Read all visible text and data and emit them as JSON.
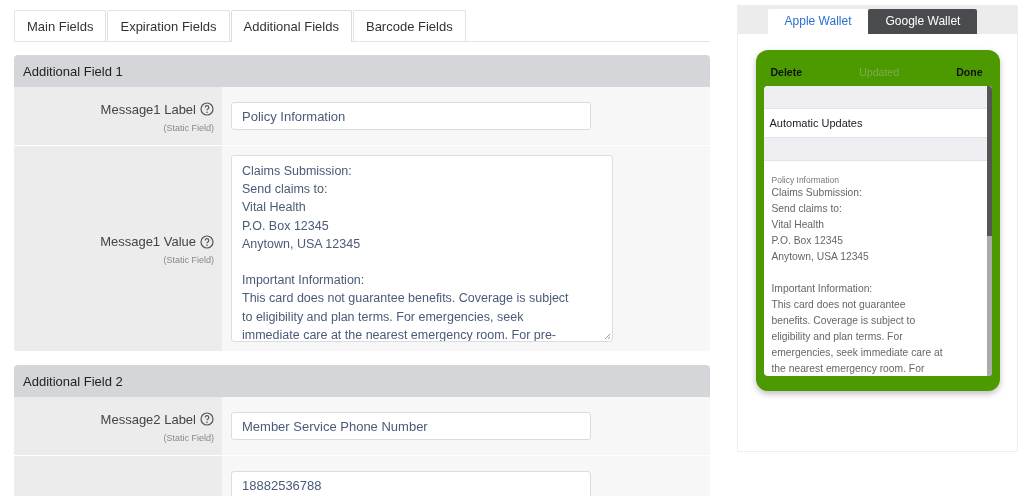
{
  "tabs": [
    {
      "label": "Main Fields",
      "selected": false
    },
    {
      "label": "Expiration Fields",
      "selected": false
    },
    {
      "label": "Additional Fields",
      "selected": true
    },
    {
      "label": "Barcode Fields",
      "selected": false
    }
  ],
  "sections": [
    {
      "title": "Additional Field 1",
      "rows": [
        {
          "kind": "input",
          "label": "Message1 Label",
          "note": "(Static Field)",
          "value": "Policy Information"
        },
        {
          "kind": "textarea",
          "label": "Message1 Value",
          "note": "(Static Field)",
          "paragraphs": [
            [
              "Claims Submission:",
              "Send claims to:",
              "Vital Health",
              "P.O. Box 12345",
              "Anytown, USA 12345"
            ],
            [
              "Important Information:",
              "This card does not guarantee benefits. Coverage is subject",
              "to eligibility and plan terms. For emergencies, seek",
              "immediate care at the nearest emergency room. For pre-"
            ]
          ]
        }
      ]
    },
    {
      "title": "Additional Field 2",
      "rows": [
        {
          "kind": "input",
          "label": "Message2 Label",
          "note": "(Static Field)",
          "value": "Member Service Phone Number"
        },
        {
          "kind": "input",
          "value": "18882536788"
        }
      ]
    }
  ],
  "preview": {
    "tabs": [
      {
        "label": "Apple Wallet",
        "selected": true
      },
      {
        "label": "Google Wallet",
        "selected": false
      }
    ],
    "header": {
      "left": "Delete",
      "center": "Updated",
      "right": "Done"
    },
    "setting": "Automatic Updates",
    "field_label": "Policy Information",
    "paragraphs": [
      [
        "Claims Submission:",
        "Send claims to:",
        "Vital Health",
        "P.O. Box 12345",
        "Anytown, USA 12345"
      ],
      [
        "Important Information:",
        "This card does not guarantee",
        "benefits. Coverage is subject to",
        "eligibility and plan terms. For",
        "emergencies, seek immediate care at",
        "the nearest emergency room. For"
      ]
    ]
  }
}
